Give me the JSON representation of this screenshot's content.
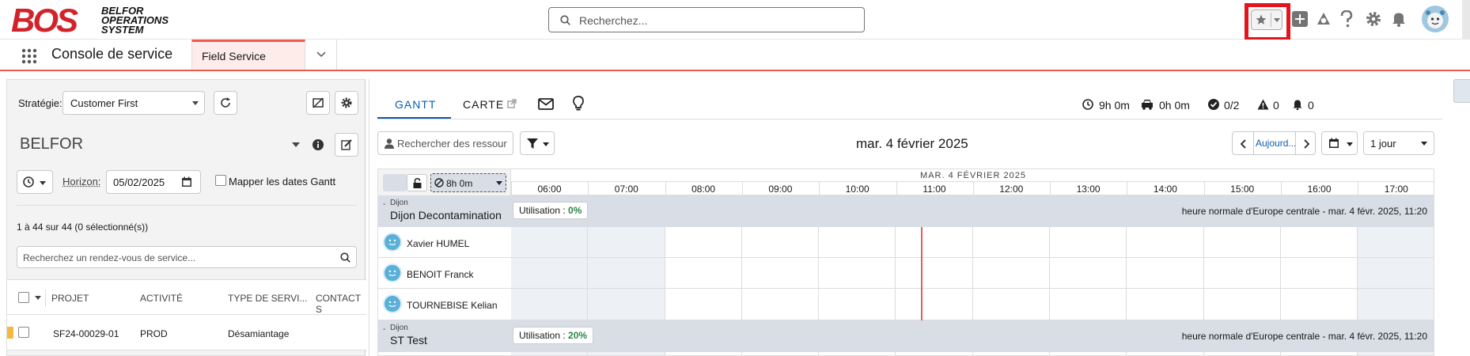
{
  "header": {
    "logo": "BOS",
    "logo_text_1": "BELFOR",
    "logo_text_2": "OPERATIONS",
    "logo_text_3": "SYSTEM",
    "search_placeholder": "Recherchez..."
  },
  "nav": {
    "app_name": "Console de service",
    "tab_label": "Field Service"
  },
  "left": {
    "strategy_label": "Stratégie:",
    "strategy_value": "Customer First",
    "territory": "BELFOR",
    "horizon_label": "Horizon:",
    "horizon_date": "05/02/2025",
    "map_dates_label": "Mapper les dates Gantt",
    "count_text": "1 à 44 sur 44 (0 sélectionné(s))",
    "search_placeholder": "Recherchez un rendez-vous de service...",
    "columns": [
      "PROJET",
      "ACTIVITÉ",
      "TYPE DE SERVI...",
      "CONTACT S"
    ],
    "rows": [
      {
        "project": "SF24-00029-01",
        "activity": "PROD",
        "service_type": "Désamiantage"
      }
    ]
  },
  "right": {
    "tabs": [
      "GANTT",
      "CARTE"
    ],
    "stats": {
      "time1": "9h 0m",
      "time2": "0h 0m",
      "done": "0/2",
      "warnings": "0",
      "alerts": "0"
    },
    "resource_search_placeholder": "Rechercher des ressour",
    "current_date": "mar. 4 février 2025",
    "today_label": "Aujourd...",
    "range_label": "1 jour",
    "gantt": {
      "date_header": "MAR. 4 FÉVRIER 2025",
      "capacity": "8h 0m",
      "hours": [
        "06:00",
        "07:00",
        "08:00",
        "09:00",
        "10:00",
        "11:00",
        "12:00",
        "13:00",
        "14:00",
        "15:00",
        "16:00",
        "17:00"
      ],
      "groups": [
        {
          "region": "Dijon",
          "name": "Dijon Decontamination",
          "util_label": "Utilisation :",
          "util_value": "0%",
          "tz": "heure normale d'Europe centrale - mar. 4 févr. 2025, 11:20",
          "resources": [
            "Xavier HUMEL",
            "BENOIT Franck",
            "TOURNEBISE Kelian"
          ]
        },
        {
          "region": "Dijon",
          "name": "ST Test",
          "util_label": "Utilisation :",
          "util_value": "20%",
          "tz": "heure normale d'Europe centrale - mar. 4 févr. 2025, 11:20",
          "resources": []
        }
      ]
    }
  }
}
